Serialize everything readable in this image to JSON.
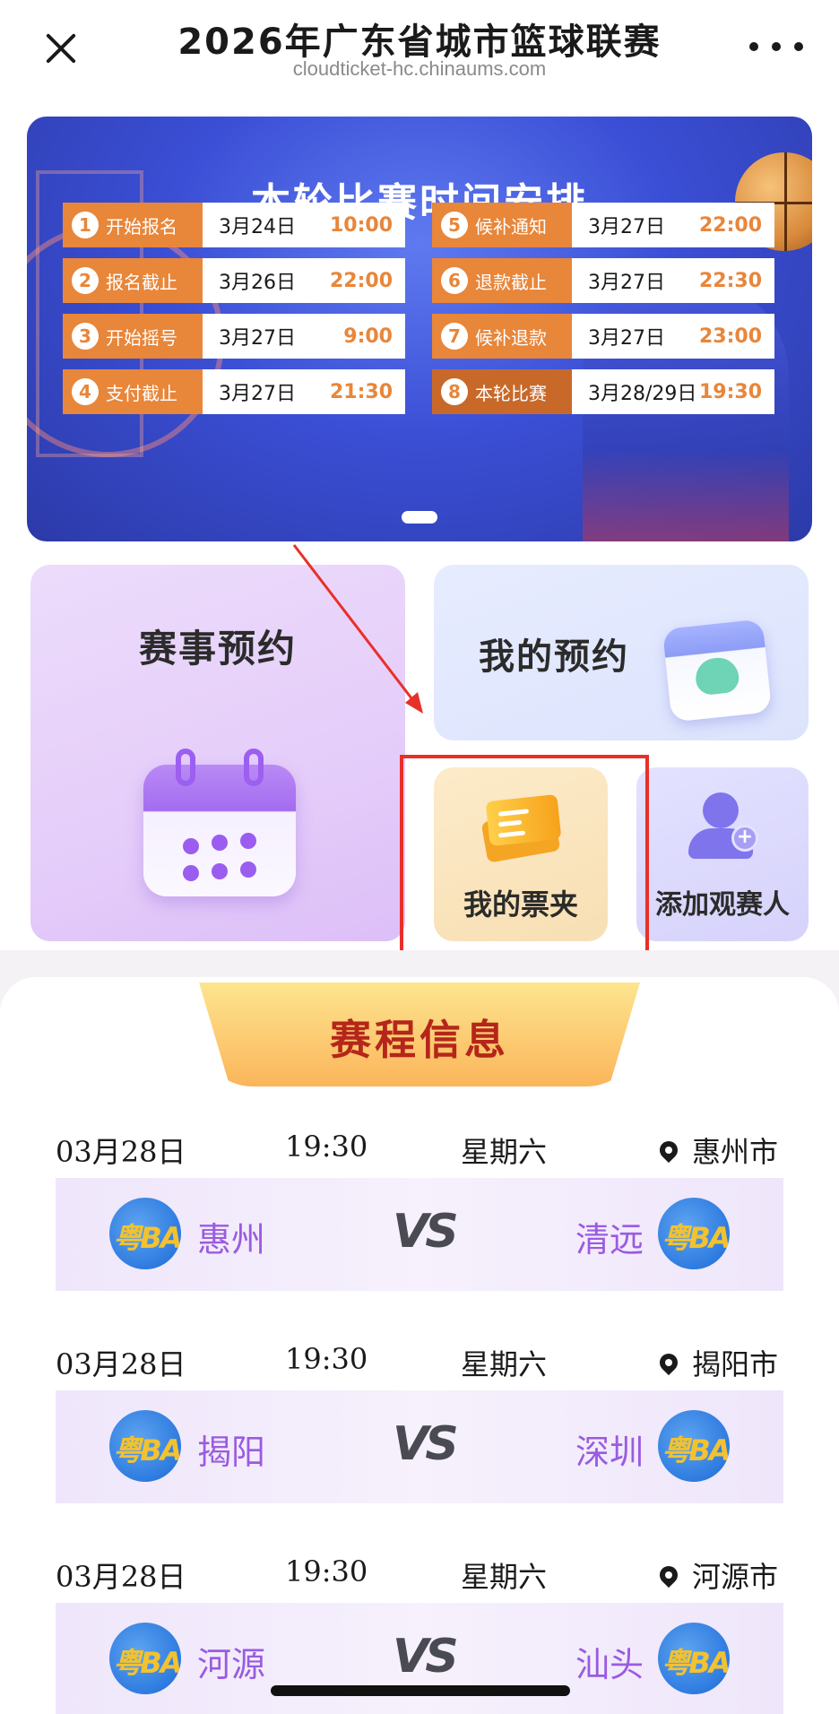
{
  "header": {
    "title": "2026年广东省城市篮球联赛",
    "url": "cloudticket-hc.chinaums.com"
  },
  "banner": {
    "title": "本轮比赛时间安排",
    "left": [
      {
        "num": "1",
        "label": "开始报名",
        "date": "3月24日",
        "time": "10:00"
      },
      {
        "num": "2",
        "label": "报名截止",
        "date": "3月26日",
        "time": "22:00"
      },
      {
        "num": "3",
        "label": "开始摇号",
        "date": "3月27日",
        "time": "9:00"
      },
      {
        "num": "4",
        "label": "支付截止",
        "date": "3月27日",
        "time": "21:30"
      }
    ],
    "right": [
      {
        "num": "5",
        "label": "候补通知",
        "date": "3月27日",
        "time": "22:00"
      },
      {
        "num": "6",
        "label": "退款截止",
        "date": "3月27日",
        "time": "22:30"
      },
      {
        "num": "7",
        "label": "候补退款",
        "date": "3月27日",
        "time": "23:00"
      },
      {
        "num": "8",
        "label": "本轮比赛",
        "date": "3月28/29日",
        "time": "19:30"
      }
    ]
  },
  "cards": {
    "reserve": "赛事预约",
    "my_reservation": "我的预约",
    "my_tickets": "我的票夹",
    "add_spectator": "添加观赛人"
  },
  "schedule": {
    "title": "赛程信息",
    "logo_text": "粤BA",
    "vs": "VS",
    "matches": [
      {
        "date": "03月28日",
        "time": "19:30",
        "weekday": "星期六",
        "location": "惠州市",
        "home": "惠州",
        "away": "清远"
      },
      {
        "date": "03月28日",
        "time": "19:30",
        "weekday": "星期六",
        "location": "揭阳市",
        "home": "揭阳",
        "away": "深圳"
      },
      {
        "date": "03月28日",
        "time": "19:30",
        "weekday": "星期六",
        "location": "河源市",
        "home": "河源",
        "away": "汕头"
      }
    ]
  },
  "colors": {
    "accent_orange": "#e8863a",
    "team_purple": "#9a5be0",
    "schedule_title_red": "#b5261a",
    "annotation_red": "#e8302a"
  }
}
